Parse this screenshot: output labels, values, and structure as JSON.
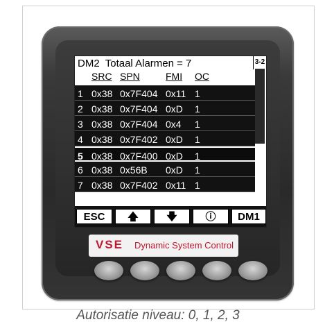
{
  "screen": {
    "title": "DM2  Totaal Alarmen = 7",
    "page_indicator": "3-2",
    "columns": [
      "SRC",
      "SPN",
      "FMI",
      "OC"
    ],
    "rows": [
      {
        "n": "1",
        "src": "0x38",
        "spn": "0x7F404",
        "fmi": "0x11",
        "oc": "1",
        "selected": false
      },
      {
        "n": "2",
        "src": "0x38",
        "spn": "0x7F404",
        "fmi": "0xD",
        "oc": "1",
        "selected": false
      },
      {
        "n": "3",
        "src": "0x38",
        "spn": "0x7F404",
        "fmi": "0x4",
        "oc": "1",
        "selected": false
      },
      {
        "n": "4",
        "src": "0x38",
        "spn": "0x7F402",
        "fmi": "0xD",
        "oc": "1",
        "selected": false
      },
      {
        "n": "5",
        "src": "0x38",
        "spn": "0x7F400",
        "fmi": "0xD",
        "oc": "1",
        "selected": true
      },
      {
        "n": "6",
        "src": "0x38",
        "spn": "0x56B",
        "fmi": "0xD",
        "oc": "1",
        "selected": false
      },
      {
        "n": "7",
        "src": "0x38",
        "spn": "0x7F402",
        "fmi": "0x11",
        "oc": "1",
        "selected": false
      }
    ],
    "softkeys": {
      "esc": "ESC",
      "up": "🡅",
      "down": "🡇",
      "info": "ⓘ",
      "dm1": "DM1"
    }
  },
  "brand": {
    "logo": "VSE",
    "tagline": "Dynamic System Control",
    "color": "#c0162e"
  },
  "caption": "Autorisatie niveau: 0, 1, 2, 3"
}
